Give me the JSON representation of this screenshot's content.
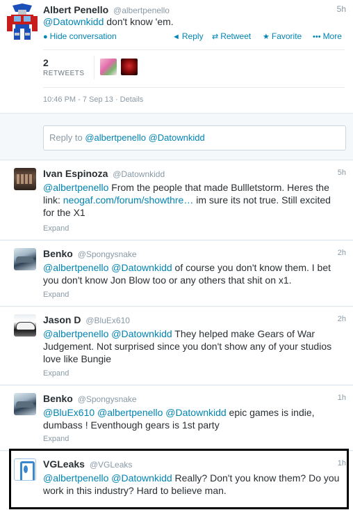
{
  "main": {
    "name": "Albert Penello",
    "handle": "@albertpenello",
    "time": "5h",
    "text_mention": "@Datownkidd",
    "text_rest": " don't know 'em.",
    "hide_conversation": "Hide conversation",
    "actions": {
      "reply": "Reply",
      "retweet": "Retweet",
      "favorite": "Favorite",
      "more": "More"
    },
    "retweet_count": "2",
    "retweet_label": "RETWEETS",
    "timestamp": "10:46 PM - 7 Sep 13 · Details"
  },
  "reply_box": {
    "prefix": "Reply to ",
    "mentions": "@albertpenello @Datownkidd"
  },
  "replies": [
    {
      "name": "Ivan Espinoza",
      "handle": "@Datownkidd",
      "time": "5h",
      "mention": "@albertpenello",
      "text1": " From the people that made Bullletstorm. Heres the link: ",
      "link": "neogaf.com/forum/showthre…",
      "text2": " im sure its not true. Still excited for the X1",
      "expand": "Expand"
    },
    {
      "name": "Benko",
      "handle": "@Spongysnake",
      "time": "2h",
      "mention": "@albertpenello @Datownkidd",
      "text": " of course you don't know them. I bet you don't know Jon Blow too or any others that shit on x1.",
      "expand": "Expand"
    },
    {
      "name": "Jason D",
      "handle": "@BluEx610",
      "time": "2h",
      "mention": "@albertpenello @Datownkidd",
      "text": " They helped make Gears of War Judgement.  Not surprised since you don't show any of your studios love like Bungie",
      "expand": "Expand"
    },
    {
      "name": "Benko",
      "handle": "@Spongysnake",
      "time": "1h",
      "mention": "@BluEx610 @albertpenello @Datownkidd",
      "text": " epic games is indie, dumbass ! Eventhough gears is 1st party",
      "expand": "Expand"
    },
    {
      "name": "VGLeaks",
      "handle": "@VGLeaks",
      "time": "1h",
      "mention": "@albertpenello @Datownkidd",
      "text": " Really? Don't you know them? Do you work in this industry? Hard to believe man."
    }
  ]
}
